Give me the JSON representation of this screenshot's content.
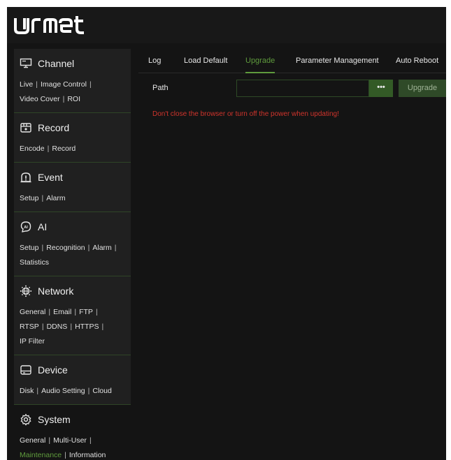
{
  "brand": {
    "logo_text": "urmet"
  },
  "sidebar": {
    "sections": [
      {
        "key": "channel",
        "title": "Channel",
        "icon": "monitor-icon",
        "links": [
          "Live",
          "Image Control",
          "Video Cover",
          "ROI"
        ]
      },
      {
        "key": "record",
        "title": "Record",
        "icon": "record-icon",
        "links": [
          "Encode",
          "Record"
        ]
      },
      {
        "key": "event",
        "title": "Event",
        "icon": "event-icon",
        "links": [
          "Setup",
          "Alarm"
        ]
      },
      {
        "key": "ai",
        "title": "AI",
        "icon": "ai-icon",
        "links": [
          "Setup",
          "Recognition",
          "Alarm",
          "Statistics"
        ]
      },
      {
        "key": "network",
        "title": "Network",
        "icon": "network-icon",
        "links": [
          "General",
          "Email",
          "FTP",
          "RTSP",
          "DDNS",
          "HTTPS",
          "IP Filter"
        ]
      },
      {
        "key": "device",
        "title": "Device",
        "icon": "device-icon",
        "links": [
          "Disk",
          "Audio Setting",
          "Cloud"
        ]
      },
      {
        "key": "system",
        "title": "System",
        "icon": "gear-icon",
        "links": [
          "General",
          "Multi-User",
          "Maintenance",
          "Information"
        ],
        "active_link": "Maintenance"
      }
    ]
  },
  "tabs": [
    {
      "label": "Log"
    },
    {
      "label": "Load Default"
    },
    {
      "label": "Upgrade",
      "active": true
    },
    {
      "label": "Parameter Management"
    },
    {
      "label": "Auto Reboot"
    }
  ],
  "upgrade": {
    "path_label": "Path",
    "path_value": "",
    "browse_label": "•••",
    "upgrade_button": "Upgrade",
    "warning": "Don't close the browser or turn off the power when updating!"
  },
  "colors": {
    "accent": "#5f9b3d",
    "warning": "#d0342c",
    "background": "#141414",
    "sidebar": "#202020"
  }
}
